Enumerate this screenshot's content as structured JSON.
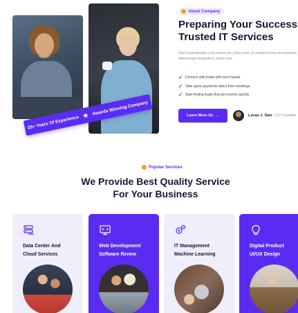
{
  "about": {
    "tag": "About Company",
    "title_line1": "Preparing Your Success",
    "title_line2": "Trusted IT Services",
    "description": "Sed ut perspiciatis unde omnis iste natus error sit volupta temes accusantium doloremque laudantium, totam rem",
    "checklist": [
      "Connect with leads with zero hassle.",
      "Take quick payments direct from meetings",
      "Start finding leads that get coverts quickly"
    ],
    "button_label": "Learn More Us",
    "button_arrow": "→",
    "author_name": "Lucas J. Swe",
    "author_sep": " / ",
    "author_role": "CO Founder",
    "ribbon_left": "25+ Years Of Experience",
    "ribbon_star": "★",
    "ribbon_right": "Awards Winning Company"
  },
  "services": {
    "tag": "Popular Services",
    "title_line1": "We Provide Best Quality Service",
    "title_line2": "For Your Business",
    "cards": [
      {
        "title_line1": "Data Center And",
        "title_line2": "Cloud Services",
        "icon": "server-icon"
      },
      {
        "title_line1": "Web Development",
        "title_line2": "Software Renew",
        "icon": "monitor-icon"
      },
      {
        "title_line1": "IT Management",
        "title_line2": "Machine Learning",
        "icon": "gears-icon"
      },
      {
        "title_line1": "Digital Product",
        "title_line2": "UI/UX Design",
        "icon": "bulb-icon"
      }
    ]
  },
  "colors": {
    "accent": "#5a2cf2",
    "accent_light": "#f1eefc",
    "heading": "#141833",
    "muted": "#8a8fa3",
    "tag_dot": "#f4a41d"
  }
}
